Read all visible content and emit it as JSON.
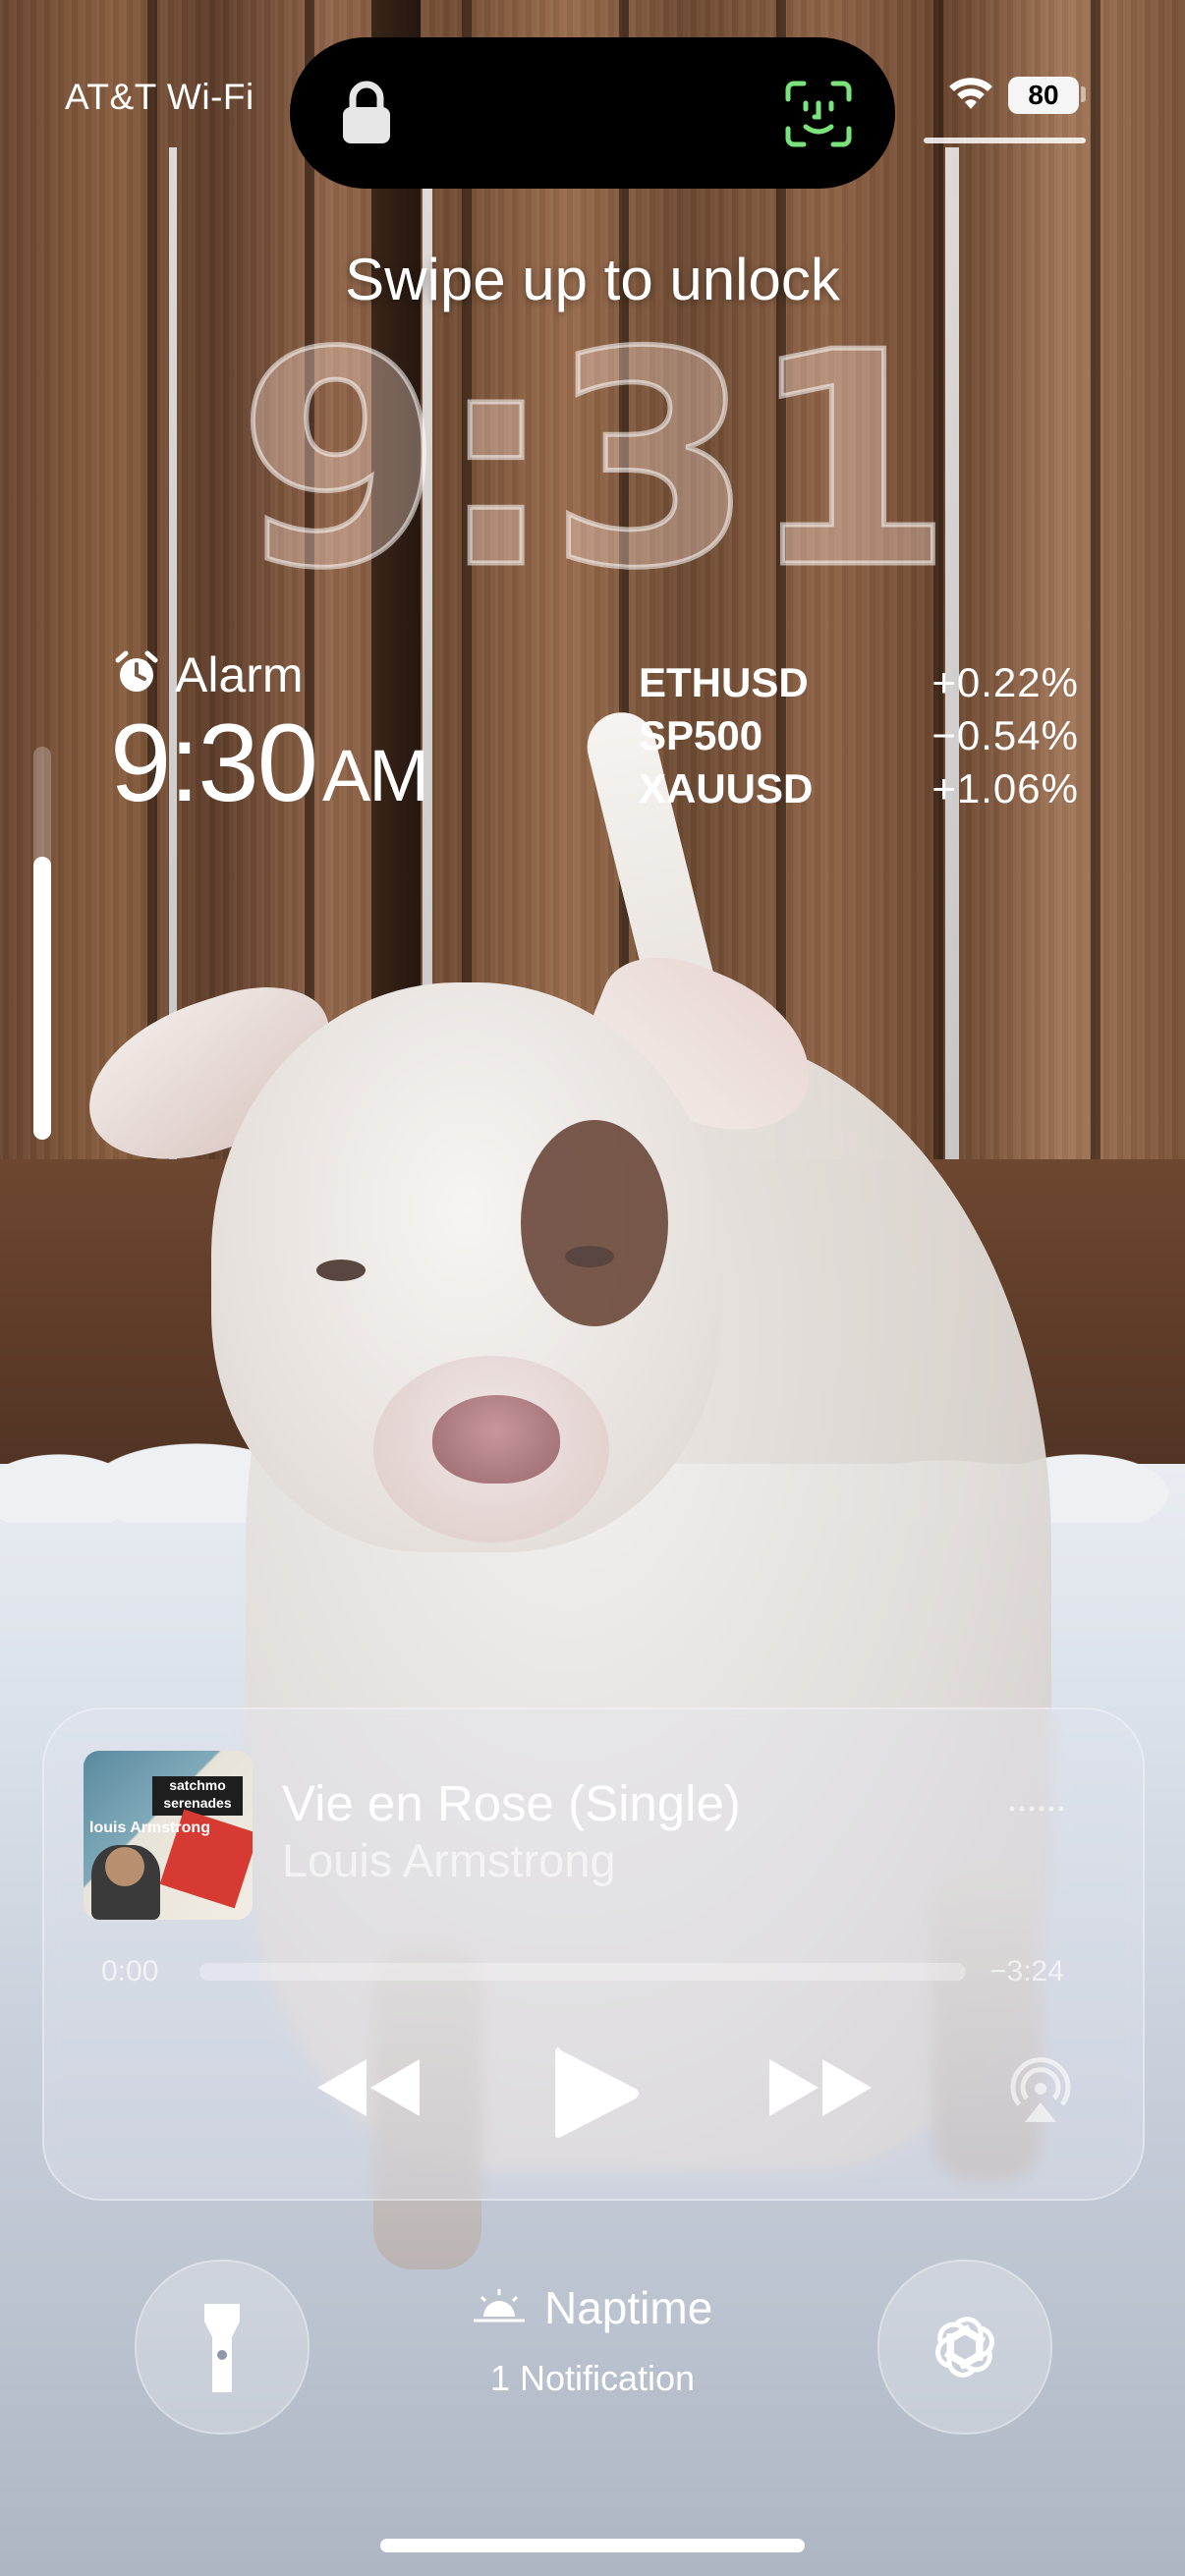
{
  "status_bar": {
    "carrier": "AT&T Wi-Fi",
    "battery": "80"
  },
  "lock_screen": {
    "hint": "Swipe up to unlock",
    "time": "9:31"
  },
  "alarm_widget": {
    "label": "Alarm",
    "time": "9:30",
    "period": "AM"
  },
  "stocks_widget": {
    "items": [
      {
        "symbol": "ETHUSD",
        "change": "+0.22%"
      },
      {
        "symbol": "SP500",
        "change": "−0.54%"
      },
      {
        "symbol": "XAUUSD",
        "change": "+1.06%"
      }
    ]
  },
  "volume": {
    "level": 0.72
  },
  "now_playing": {
    "title": "Vie en Rose (Single)",
    "artist": "Louis Armstrong",
    "elapsed": "0:00",
    "remaining": "−3:24",
    "progress": 0.0,
    "album_art": {
      "line1": "satchmo",
      "line2": "serenades",
      "name": "louis Armstrong"
    }
  },
  "bottom_bar": {
    "left_button_icon": "flashlight-icon",
    "right_button_icon": "chatgpt-icon",
    "focus_name": "Naptime",
    "notification_count": "1 Notification"
  }
}
